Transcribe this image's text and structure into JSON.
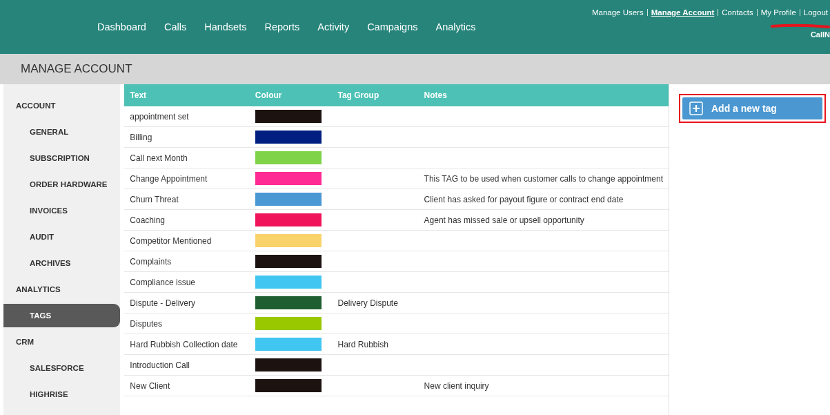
{
  "nav": {
    "items": [
      "Dashboard",
      "Calls",
      "Handsets",
      "Reports",
      "Activity",
      "Campaigns",
      "Analytics"
    ]
  },
  "top_links": [
    {
      "label": "Manage Users",
      "selected": false
    },
    {
      "label": "Manage Account",
      "selected": true
    },
    {
      "label": "Contacts",
      "selected": false
    },
    {
      "label": "My Profile",
      "selected": false
    },
    {
      "label": "Logout",
      "selected": false
    }
  ],
  "account_name": "CallN",
  "page_title": "MANAGE ACCOUNT",
  "sidebar": {
    "items": [
      {
        "kind": "heading",
        "label": "ACCOUNT",
        "selected": false
      },
      {
        "kind": "item",
        "label": "GENERAL",
        "selected": false
      },
      {
        "kind": "item",
        "label": "SUBSCRIPTION",
        "selected": false
      },
      {
        "kind": "item",
        "label": "ORDER HARDWARE",
        "selected": false
      },
      {
        "kind": "item",
        "label": "INVOICES",
        "selected": false
      },
      {
        "kind": "item",
        "label": "AUDIT",
        "selected": false
      },
      {
        "kind": "item",
        "label": "ARCHIVES",
        "selected": false
      },
      {
        "kind": "heading",
        "label": "ANALYTICS",
        "selected": false
      },
      {
        "kind": "item",
        "label": "TAGS",
        "selected": true
      },
      {
        "kind": "heading",
        "label": "CRM",
        "selected": false
      },
      {
        "kind": "item",
        "label": "SALESFORCE",
        "selected": false
      },
      {
        "kind": "item",
        "label": "HIGHRISE",
        "selected": false
      }
    ]
  },
  "table": {
    "columns": [
      "Text",
      "Colour",
      "Tag Group",
      "Notes"
    ],
    "rows": [
      {
        "text": "appointment set",
        "color": "#1c1311"
      },
      {
        "text": "Billing",
        "color": "#001f80"
      },
      {
        "text": "Call next Month",
        "color": "#7ed348"
      },
      {
        "text": "Change Appointment",
        "color": "#ff2a93",
        "notes": "This TAG to be used when customer calls to change appointment"
      },
      {
        "text": "Churn Threat",
        "color": "#4a98d3",
        "notes": "Client has asked for payout figure or contract end date"
      },
      {
        "text": "Coaching",
        "color": "#f0145a",
        "notes": "Agent has missed sale or upsell opportunity"
      },
      {
        "text": "Competitor Mentioned",
        "color": "#fad26a"
      },
      {
        "text": "Complaints",
        "color": "#1c1311"
      },
      {
        "text": "Compliance issue",
        "color": "#40c6f0"
      },
      {
        "text": "Dispute - Delivery",
        "color": "#1e5e30",
        "tag_group": "Delivery Dispute"
      },
      {
        "text": "Disputes",
        "color": "#99c800"
      },
      {
        "text": "Hard Rubbish Collection date",
        "color": "#40c6f0",
        "tag_group": "Hard Rubbish"
      },
      {
        "text": "Introduction Call",
        "color": "#1c1311"
      },
      {
        "text": "New Client",
        "color": "#1c1311",
        "notes": "New client inquiry"
      }
    ]
  },
  "add_button": {
    "label": "Add a new tag"
  }
}
